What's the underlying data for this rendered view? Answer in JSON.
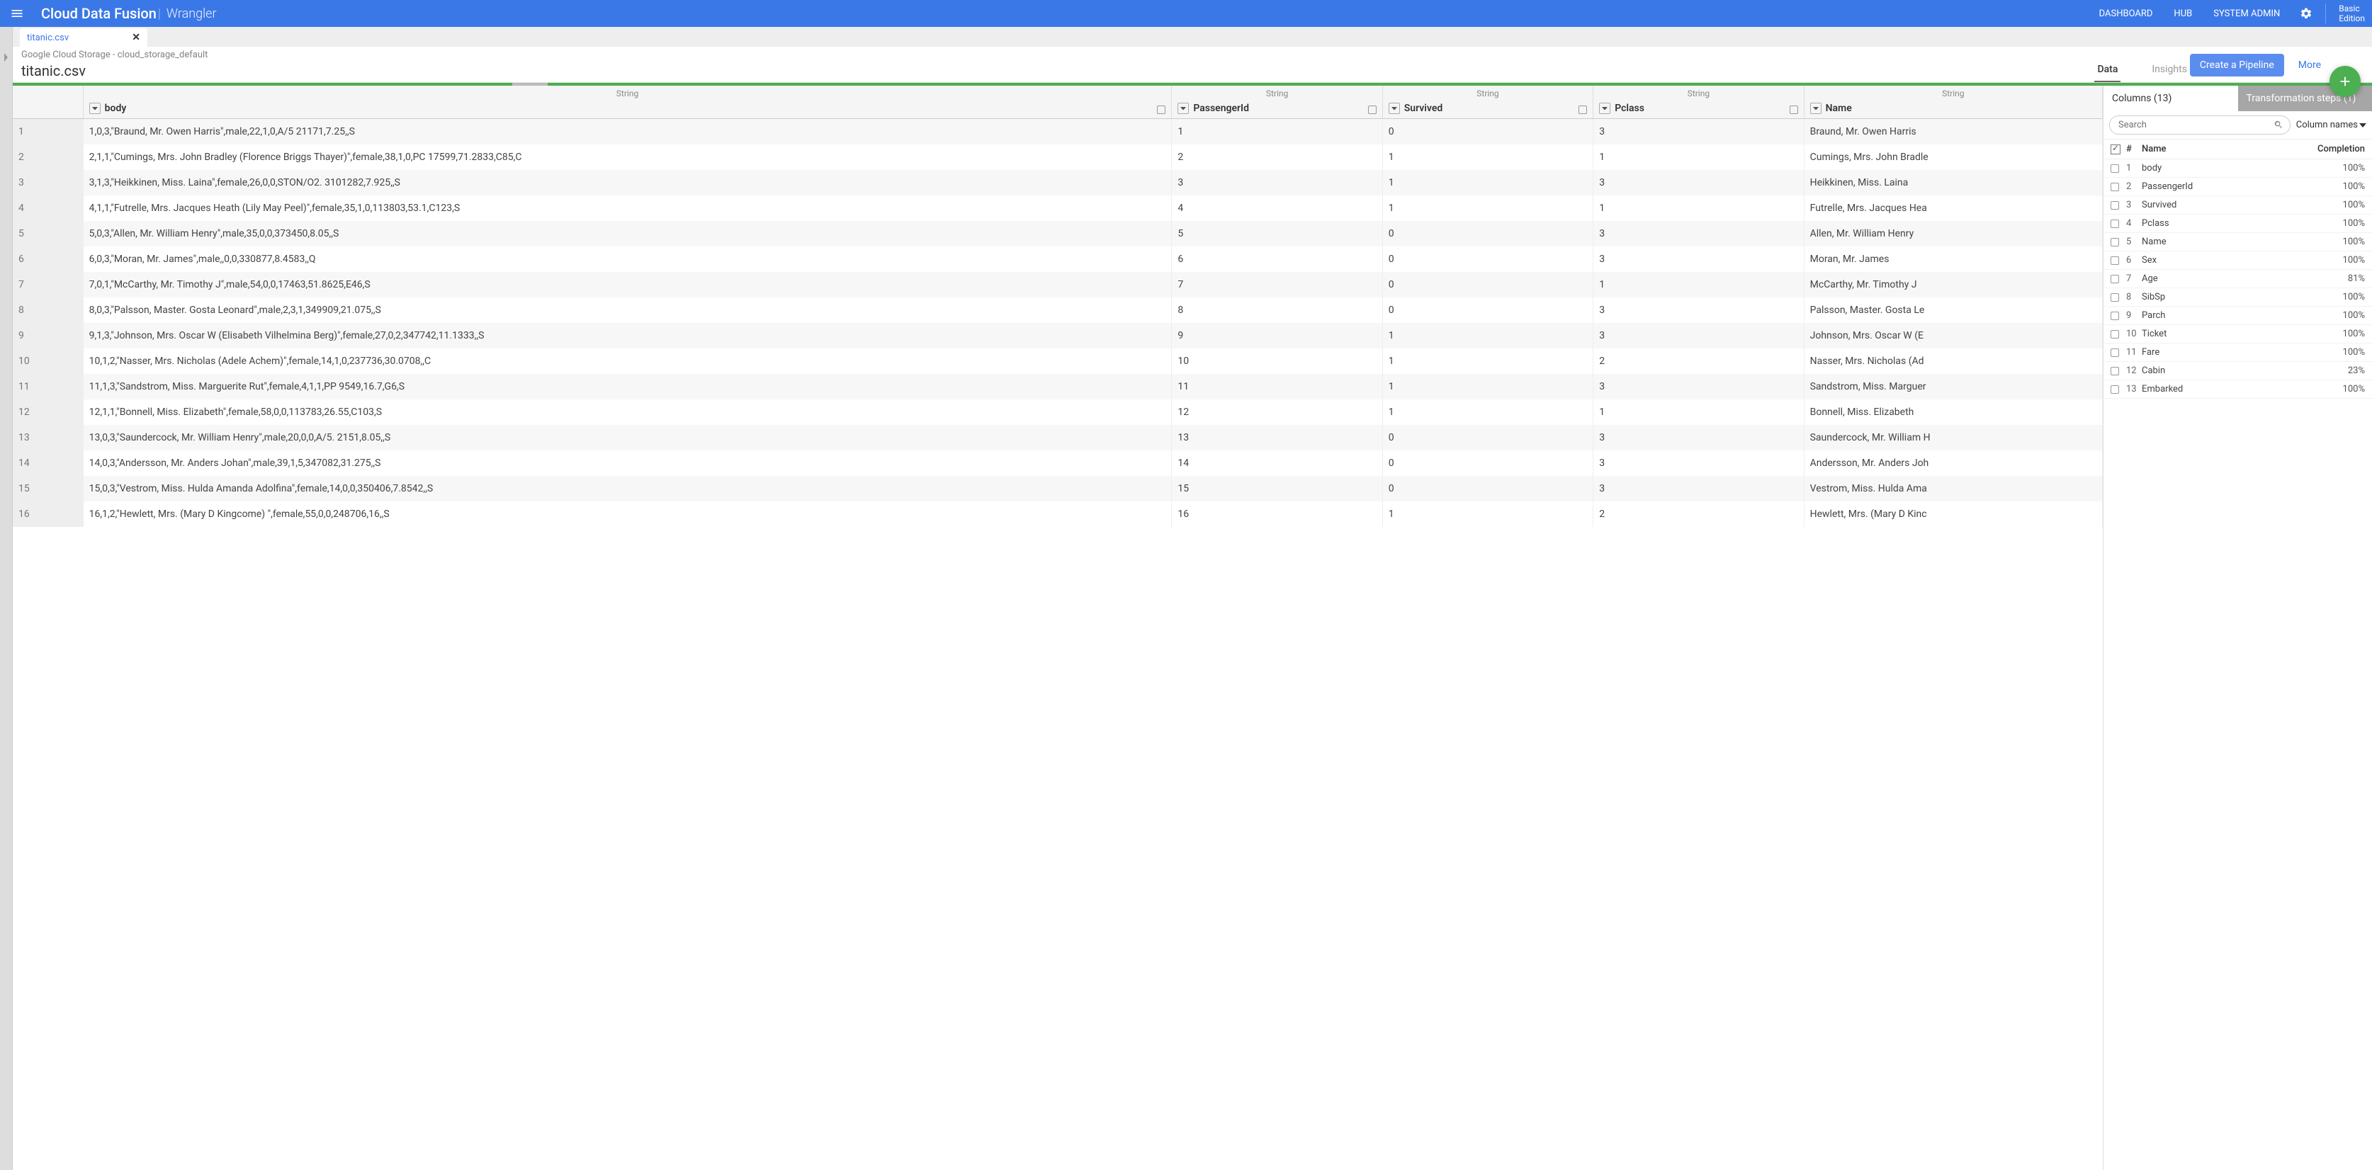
{
  "header": {
    "product": "Cloud Data Fusion",
    "section": "Wrangler",
    "links": {
      "dashboard": "DASHBOARD",
      "hub": "HUB",
      "system_admin": "SYSTEM ADMIN"
    },
    "edition_l1": "Basic",
    "edition_l2": "Edition"
  },
  "tab": {
    "filename": "titanic.csv"
  },
  "breadcrumb": "Google Cloud Storage - cloud_storage_default",
  "filename": "titanic.csv",
  "view_tabs": {
    "data": "Data",
    "insights": "Insights"
  },
  "actions": {
    "pipeline": "Create a Pipeline",
    "more": "More"
  },
  "grid": {
    "type_label": "String",
    "columns": [
      {
        "name": "body"
      },
      {
        "name": "PassengerId"
      },
      {
        "name": "Survived"
      },
      {
        "name": "Pclass"
      },
      {
        "name": "Name"
      }
    ],
    "rows": [
      {
        "n": "1",
        "body": "1,0,3,\"Braund, Mr. Owen Harris\",male,22,1,0,A/5 21171,7.25,,S",
        "pid": "1",
        "surv": "0",
        "pcl": "3",
        "name": "Braund, Mr. Owen Harris"
      },
      {
        "n": "2",
        "body": "2,1,1,\"Cumings, Mrs. John Bradley (Florence Briggs Thayer)\",female,38,1,0,PC 17599,71.2833,C85,C",
        "pid": "2",
        "surv": "1",
        "pcl": "1",
        "name": "Cumings, Mrs. John Bradle"
      },
      {
        "n": "3",
        "body": "3,1,3,\"Heikkinen, Miss. Laina\",female,26,0,0,STON/O2. 3101282,7.925,,S",
        "pid": "3",
        "surv": "1",
        "pcl": "3",
        "name": "Heikkinen, Miss. Laina"
      },
      {
        "n": "4",
        "body": "4,1,1,\"Futrelle, Mrs. Jacques Heath (Lily May Peel)\",female,35,1,0,113803,53.1,C123,S",
        "pid": "4",
        "surv": "1",
        "pcl": "1",
        "name": "Futrelle, Mrs. Jacques Hea"
      },
      {
        "n": "5",
        "body": "5,0,3,\"Allen, Mr. William Henry\",male,35,0,0,373450,8.05,,S",
        "pid": "5",
        "surv": "0",
        "pcl": "3",
        "name": "Allen, Mr. William Henry"
      },
      {
        "n": "6",
        "body": "6,0,3,\"Moran, Mr. James\",male,,0,0,330877,8.4583,,Q",
        "pid": "6",
        "surv": "0",
        "pcl": "3",
        "name": "Moran, Mr. James"
      },
      {
        "n": "7",
        "body": "7,0,1,\"McCarthy, Mr. Timothy J\",male,54,0,0,17463,51.8625,E46,S",
        "pid": "7",
        "surv": "0",
        "pcl": "1",
        "name": "McCarthy, Mr. Timothy J"
      },
      {
        "n": "8",
        "body": "8,0,3,\"Palsson, Master. Gosta Leonard\",male,2,3,1,349909,21.075,,S",
        "pid": "8",
        "surv": "0",
        "pcl": "3",
        "name": "Palsson, Master. Gosta Le"
      },
      {
        "n": "9",
        "body": "9,1,3,\"Johnson, Mrs. Oscar W (Elisabeth Vilhelmina Berg)\",female,27,0,2,347742,11.1333,,S",
        "pid": "9",
        "surv": "1",
        "pcl": "3",
        "name": "Johnson, Mrs. Oscar W (E"
      },
      {
        "n": "10",
        "body": "10,1,2,\"Nasser, Mrs. Nicholas (Adele Achem)\",female,14,1,0,237736,30.0708,,C",
        "pid": "10",
        "surv": "1",
        "pcl": "2",
        "name": "Nasser, Mrs. Nicholas (Ad"
      },
      {
        "n": "11",
        "body": "11,1,3,\"Sandstrom, Miss. Marguerite Rut\",female,4,1,1,PP 9549,16.7,G6,S",
        "pid": "11",
        "surv": "1",
        "pcl": "3",
        "name": "Sandstrom, Miss. Marguer"
      },
      {
        "n": "12",
        "body": "12,1,1,\"Bonnell, Miss. Elizabeth\",female,58,0,0,113783,26.55,C103,S",
        "pid": "12",
        "surv": "1",
        "pcl": "1",
        "name": "Bonnell, Miss. Elizabeth"
      },
      {
        "n": "13",
        "body": "13,0,3,\"Saundercock, Mr. William Henry\",male,20,0,0,A/5. 2151,8.05,,S",
        "pid": "13",
        "surv": "0",
        "pcl": "3",
        "name": "Saundercock, Mr. William H"
      },
      {
        "n": "14",
        "body": "14,0,3,\"Andersson, Mr. Anders Johan\",male,39,1,5,347082,31.275,,S",
        "pid": "14",
        "surv": "0",
        "pcl": "3",
        "name": "Andersson, Mr. Anders Joh"
      },
      {
        "n": "15",
        "body": "15,0,3,\"Vestrom, Miss. Hulda Amanda Adolfina\",female,14,0,0,350406,7.8542,,S",
        "pid": "15",
        "surv": "0",
        "pcl": "3",
        "name": "Vestrom, Miss. Hulda Ama"
      },
      {
        "n": "16",
        "body": "16,1,2,\"Hewlett, Mrs. (Mary D Kingcome) \",female,55,0,0,248706,16,,S",
        "pid": "16",
        "surv": "1",
        "pcl": "2",
        "name": "Hewlett, Mrs. (Mary D Kinc"
      }
    ]
  },
  "sidepanel": {
    "tab_columns": "Columns (13)",
    "tab_steps": "Transformation steps (1)",
    "search_placeholder": "Search",
    "mode_label": "Column names",
    "head_num": "#",
    "head_name": "Name",
    "head_completion": "Completion",
    "cols": [
      {
        "n": "1",
        "name": "body",
        "c": "100%"
      },
      {
        "n": "2",
        "name": "PassengerId",
        "c": "100%"
      },
      {
        "n": "3",
        "name": "Survived",
        "c": "100%"
      },
      {
        "n": "4",
        "name": "Pclass",
        "c": "100%"
      },
      {
        "n": "5",
        "name": "Name",
        "c": "100%"
      },
      {
        "n": "6",
        "name": "Sex",
        "c": "100%"
      },
      {
        "n": "7",
        "name": "Age",
        "c": "81%"
      },
      {
        "n": "8",
        "name": "SibSp",
        "c": "100%"
      },
      {
        "n": "9",
        "name": "Parch",
        "c": "100%"
      },
      {
        "n": "10",
        "name": "Ticket",
        "c": "100%"
      },
      {
        "n": "11",
        "name": "Fare",
        "c": "100%"
      },
      {
        "n": "12",
        "name": "Cabin",
        "c": "23%"
      },
      {
        "n": "13",
        "name": "Embarked",
        "c": "100%"
      }
    ]
  }
}
